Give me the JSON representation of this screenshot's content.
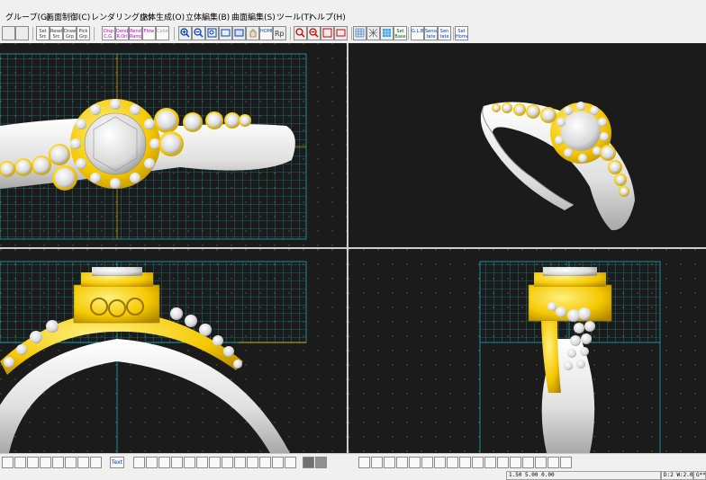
{
  "menubar": {
    "items": [
      {
        "label": "グループ(G)"
      },
      {
        "label": "画面制御(C)"
      },
      {
        "label": "レンダリング(R)"
      },
      {
        "label": "立体生成(O)"
      },
      {
        "label": "立体編集(B)"
      },
      {
        "label": "曲面編集(S)"
      },
      {
        "label": "ツール(T)"
      },
      {
        "label": "ヘルプ(H)"
      }
    ]
  },
  "toolbar": {
    "buttons": [
      {
        "label": "Set Src",
        "icon": "set-source-icon"
      },
      {
        "label": "Reset Src",
        "icon": "reset-source-icon"
      },
      {
        "label": "Draw Grp",
        "icon": "draw-group-icon"
      },
      {
        "label": "Pick Grp",
        "icon": "pick-group-icon"
      },
      {
        "label": "Disp C.G.",
        "icon": "display-cg-icon"
      },
      {
        "label": "Dend R.Ori",
        "icon": "dend-icon"
      },
      {
        "label": "Rend Ramp",
        "icon": "render-ramp-icon"
      },
      {
        "label": "Flow",
        "icon": "flow-icon"
      },
      {
        "label": "Colot",
        "icon": "color-icon"
      },
      {
        "label": "HOME",
        "icon": "home-icon"
      },
      {
        "label": "Set Base",
        "icon": "set-base-icon"
      },
      {
        "label": "G.L.B.",
        "icon": "glb-icon"
      },
      {
        "label": "Sense tate",
        "icon": "sense-tate-icon"
      },
      {
        "label": "Sen tate",
        "icon": "sen-tate-icon"
      },
      {
        "label": "Set Home",
        "icon": "set-home-icon"
      }
    ]
  },
  "bottombar": {
    "text_button": "Text"
  },
  "statusbar": {
    "coords": "1.50 5.00 0.00",
    "info": "D:2 W:2.0",
    "tail": "G**"
  },
  "colors": {
    "viewport_bg": "#1b1b1b",
    "grid": "#1ea8b8",
    "metal_gold": "#f5c800",
    "metal_white": "#e8e8e8",
    "divider": "#cfcfcf"
  },
  "viewports": [
    {
      "name": "top-view"
    },
    {
      "name": "perspective-view"
    },
    {
      "name": "front-view"
    },
    {
      "name": "side-view"
    }
  ]
}
